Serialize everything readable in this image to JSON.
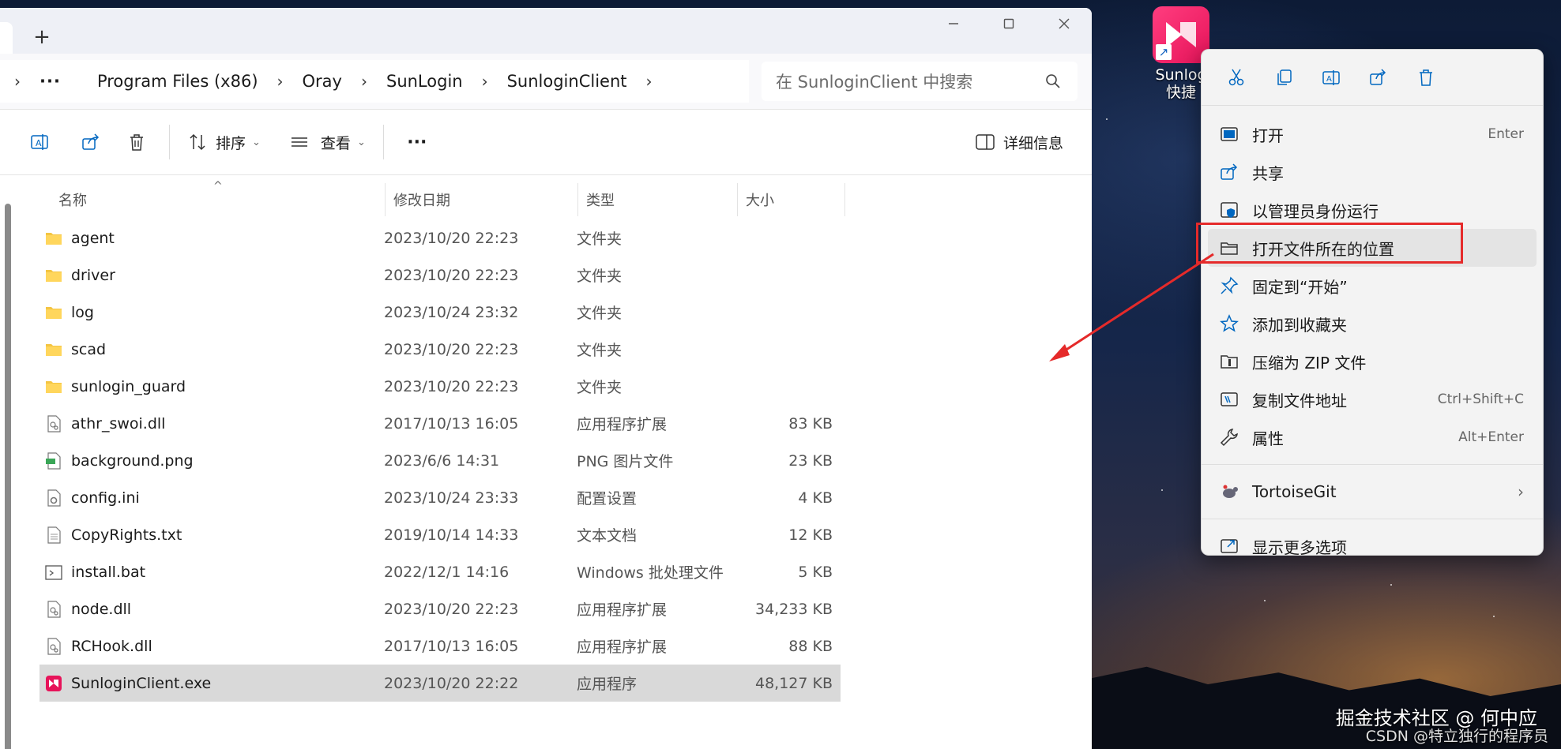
{
  "window": {
    "new_tab": "+",
    "controls": [
      "minimize",
      "maximize",
      "close"
    ]
  },
  "address": {
    "more": "···",
    "crumbs": [
      "Program Files (x86)",
      "Oray",
      "SunLogin",
      "SunloginClient"
    ],
    "search_placeholder": "在 SunloginClient 中搜索"
  },
  "toolbar": {
    "sort_label": "排序",
    "view_label": "查看",
    "more_label": "···",
    "details_label": "详细信息"
  },
  "columns": [
    "名称",
    "修改日期",
    "类型",
    "大小"
  ],
  "files": [
    {
      "name": "agent",
      "date": "2023/10/20 22:23",
      "type": "文件夹",
      "size": "",
      "icon": "folder-icon"
    },
    {
      "name": "driver",
      "date": "2023/10/20 22:23",
      "type": "文件夹",
      "size": "",
      "icon": "folder-icon"
    },
    {
      "name": "log",
      "date": "2023/10/24 23:32",
      "type": "文件夹",
      "size": "",
      "icon": "folder-icon"
    },
    {
      "name": "scad",
      "date": "2023/10/20 22:23",
      "type": "文件夹",
      "size": "",
      "icon": "folder-icon"
    },
    {
      "name": "sunlogin_guard",
      "date": "2023/10/20 22:23",
      "type": "文件夹",
      "size": "",
      "icon": "folder-icon"
    },
    {
      "name": "athr_swoi.dll",
      "date": "2017/10/13 16:05",
      "type": "应用程序扩展",
      "size": "83 KB",
      "icon": "dll-icon"
    },
    {
      "name": "background.png",
      "date": "2023/6/6 14:31",
      "type": "PNG 图片文件",
      "size": "23 KB",
      "icon": "image-icon"
    },
    {
      "name": "config.ini",
      "date": "2023/10/24 23:33",
      "type": "配置设置",
      "size": "4 KB",
      "icon": "config-icon"
    },
    {
      "name": "CopyRights.txt",
      "date": "2019/10/14 14:33",
      "type": "文本文档",
      "size": "12 KB",
      "icon": "text-icon"
    },
    {
      "name": "install.bat",
      "date": "2022/12/1 14:16",
      "type": "Windows 批处理文件",
      "size": "5 KB",
      "icon": "batch-icon"
    },
    {
      "name": "node.dll",
      "date": "2023/10/20 22:23",
      "type": "应用程序扩展",
      "size": "34,233 KB",
      "icon": "dll-icon"
    },
    {
      "name": "RCHook.dll",
      "date": "2017/10/13 16:05",
      "type": "应用程序扩展",
      "size": "88 KB",
      "icon": "dll-icon"
    },
    {
      "name": "SunloginClient.exe",
      "date": "2023/10/20 22:22",
      "type": "应用程序",
      "size": "48,127 KB",
      "icon": "sunlogin-app-icon",
      "selected": true
    }
  ],
  "shortcut": {
    "label_line1": "Sunlog",
    "label_line2": "快捷"
  },
  "context_menu": {
    "items": [
      {
        "label": "打开",
        "shortcut": "Enter"
      },
      {
        "label": "共享",
        "shortcut": ""
      },
      {
        "label": "以管理员身份运行",
        "shortcut": ""
      },
      {
        "label": "打开文件所在的位置",
        "shortcut": ""
      },
      {
        "label": "固定到“开始”",
        "shortcut": ""
      },
      {
        "label": "添加到收藏夹",
        "shortcut": ""
      },
      {
        "label": "压缩为 ZIP 文件",
        "shortcut": ""
      },
      {
        "label": "复制文件地址",
        "shortcut": "Ctrl+Shift+C"
      },
      {
        "label": "属性",
        "shortcut": "Alt+Enter"
      }
    ],
    "tortoise": "TortoiseGit",
    "more_options": "显示更多选项"
  },
  "watermark": {
    "line1": "掘金技术社区 @ 何中应",
    "line2": "CSDN @特立独行的程序员"
  },
  "colors": {
    "accent": "#0067c0",
    "highlight_red": "#e52a2a",
    "sunlogin_pink": "#e7145a",
    "folder_yellow": "#f4c543"
  }
}
